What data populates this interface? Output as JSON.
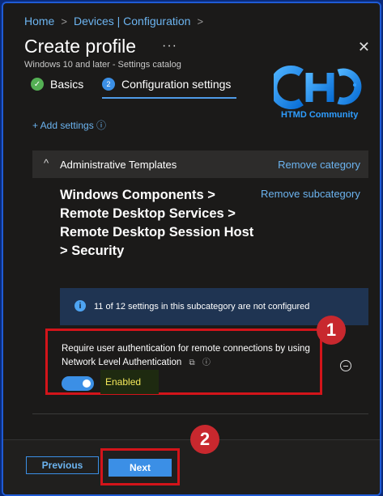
{
  "breadcrumb": {
    "home": "Home",
    "devices": "Devices | Configuration",
    "sep": ">"
  },
  "header": {
    "title": "Create profile",
    "more": "···",
    "close": "✕",
    "subtitle": "Windows 10 and later - Settings catalog"
  },
  "steps": [
    {
      "number": "✓",
      "label": "Basics"
    },
    {
      "number": "2",
      "label": "Configuration settings"
    }
  ],
  "logo": {
    "text": "HTMD Community"
  },
  "add_settings": "+ Add settings ⓘ",
  "category": {
    "chevron": "^",
    "name": "Administrative Templates",
    "remove_label": "Remove category"
  },
  "subcategory": {
    "title": "Windows Components > Remote Desktop Services > Remote Desktop Session Host > Security",
    "remove_label": "Remove subcategory"
  },
  "info": {
    "icon": "i",
    "text": "11 of 12 settings in this subcategory are not configured"
  },
  "setting": {
    "label": "Require user authentication for remote connections by using Network Level Authentication",
    "copy_icon": "⧉",
    "info_icon": "ⓘ",
    "state": "Enabled",
    "enabled": true
  },
  "annotations": {
    "badge1": "1",
    "badge2": "2"
  },
  "footer": {
    "previous": "Previous",
    "next": "Next"
  },
  "colors": {
    "accent": "#3b8fe6",
    "link": "#6cb4f0",
    "highlight_red": "#d3141a",
    "background": "#1b1a19"
  }
}
